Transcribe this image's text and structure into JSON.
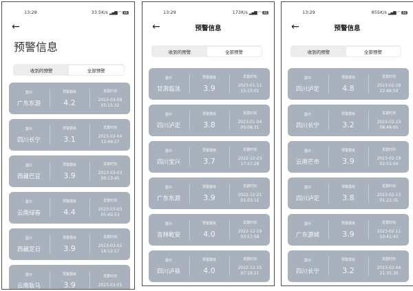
{
  "screens": [
    {
      "status": {
        "time": "13:28",
        "net": "33.5K/s",
        "battery": "46"
      },
      "title": "预警信息",
      "tabs": [
        {
          "label": "收到的预警",
          "active": true
        },
        {
          "label": "全部预警",
          "active": false
        }
      ],
      "cards": [
        {
          "region": "广东东源",
          "level": "4.2",
          "date": "2023-03-08",
          "time": "05:15:32"
        },
        {
          "region": "四川长宁",
          "level": "3.1",
          "date": "2023-03-04",
          "time": "12:49:27"
        },
        {
          "region": "西藏巴宜",
          "level": "3.9",
          "date": "2023-03-03",
          "time": "09:13:45"
        },
        {
          "region": "云南绿春",
          "level": "4.4",
          "date": "2023-03-03",
          "time": "05:49:53"
        },
        {
          "region": "西藏定日",
          "level": "3.9",
          "date": "2023-03-02",
          "time": "16:12:57"
        },
        {
          "region": "云南耿马",
          "level": "3.9",
          "date": "2023-03-01",
          "time": ""
        }
      ]
    },
    {
      "status": {
        "time": "13:29",
        "net": "173K/s",
        "battery": "46"
      },
      "title": "预警信息",
      "tabs": [
        {
          "label": "收到的预警",
          "active": false
        },
        {
          "label": "全部预警",
          "active": true
        }
      ],
      "cards": [
        {
          "region": "甘肃临洮",
          "level": "3.9",
          "date": "2023-01-11",
          "time": "15:15:01"
        },
        {
          "region": "四川泸定",
          "level": "3.8",
          "date": "2023-01-04",
          "time": "00:08:31"
        },
        {
          "region": "四川宝兴",
          "level": "3.7",
          "date": "2022-12-23",
          "time": "17:57:28"
        },
        {
          "region": "广东东源",
          "level": "3.9",
          "date": "2022-12-21",
          "time": "01:03:12"
        },
        {
          "region": "吉林乾安",
          "level": "4.0",
          "date": "2022-12-19",
          "time": "03:57:58"
        },
        {
          "region": "四川泸县",
          "level": "4.0",
          "date": "2022-12-15",
          "time": "07:18:21"
        }
      ]
    },
    {
      "status": {
        "time": "13:29",
        "net": "855K/s",
        "battery": "46"
      },
      "title": "预警信息",
      "tabs": [
        {
          "label": "收到的预警",
          "active": false
        },
        {
          "label": "全部预警",
          "active": true
        }
      ],
      "cards": [
        {
          "region": "四川泸定",
          "level": "4.8",
          "date": "2023-02-28",
          "time": "22:46:50"
        },
        {
          "region": "四川长宁",
          "level": "3.2",
          "date": "2023-02-23",
          "time": "08:48:00"
        },
        {
          "region": "云南芒市",
          "level": "3.9",
          "date": "2023-02-19",
          "time": "02:53:04"
        },
        {
          "region": "四川泸定",
          "level": "3.8",
          "date": "2023-02-13",
          "time": "01:23:35"
        },
        {
          "region": "广东源城",
          "level": "3.9",
          "date": "2023-02-11",
          "time": "10:41:43"
        },
        {
          "region": "四川长宁",
          "level": "3.2",
          "date": "2023-02-04",
          "time": "21:35:30"
        }
      ]
    }
  ],
  "labels": {
    "epicenter": "震中",
    "level": "预警震级",
    "issued": "发震时刻"
  },
  "icons": {
    "back": "back-arrow-icon",
    "wifi": "wifi-icon",
    "signal": "signal-icon",
    "battery": "battery-icon"
  },
  "colors": {
    "card": "#a9b1bc",
    "tab_bg": "#ececec"
  }
}
